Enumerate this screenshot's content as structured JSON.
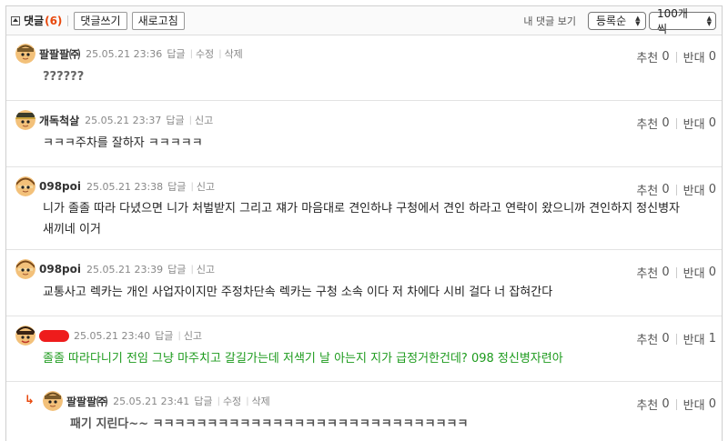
{
  "toolbar": {
    "title": "댓글",
    "count": "(6)",
    "write_label": "댓글쓰기",
    "refresh_label": "새로고침",
    "view_mine_label": "내 댓글 보기",
    "sort_value": "등록순",
    "page_size_value": "100개씩"
  },
  "comments": [
    {
      "nick": "팔팔팔㈜",
      "date": "25.05.21 23:36",
      "actions": [
        "답글",
        "수정",
        "삭제"
      ],
      "text": "??????",
      "up_label": "추천",
      "up": "0",
      "down_label": "반대",
      "down": "0"
    },
    {
      "nick": "개독척살",
      "date": "25.05.21 23:37",
      "actions": [
        "답글",
        "신고"
      ],
      "text": "ㅋㅋㅋ주차를 잘하자 ㅋㅋㅋㅋㅋ",
      "up_label": "추천",
      "up": "0",
      "down_label": "반대",
      "down": "0"
    },
    {
      "nick": "098poi",
      "date": "25.05.21 23:38",
      "actions": [
        "답글",
        "신고"
      ],
      "text": "니가 졸졸 따라 다녔으면 니가 처벌받지 그리고 쟤가 마음대로 견인하냐 구청에서 견인 하라고 연락이 왔으니까 견인하지 정신병자 새끼네 이거",
      "up_label": "추천",
      "up": "0",
      "down_label": "반대",
      "down": "0"
    },
    {
      "nick": "098poi",
      "date": "25.05.21 23:39",
      "actions": [
        "답글",
        "신고"
      ],
      "text": "교통사고 렉카는 개인 사업자이지만 주정차단속 렉카는 구청 소속 이다 저 차에다 시비 걸다 너 잡혀간다",
      "up_label": "추천",
      "up": "0",
      "down_label": "반대",
      "down": "0"
    },
    {
      "nick": "",
      "date": "25.05.21 23:40",
      "actions": [
        "답글",
        "신고"
      ],
      "text": "졸졸 따라다니기 전임 그냥 마주치고 갈길가는데 저색기 날 아는지 지가 급정거한건데? 098 정신병자련아",
      "up_label": "추천",
      "up": "0",
      "down_label": "반대",
      "down": "1"
    },
    {
      "nick": "팔팔팔㈜",
      "date": "25.05.21 23:41",
      "actions": [
        "답글",
        "수정",
        "삭제"
      ],
      "text": "패기 지린다~~ ㅋㅋㅋㅋㅋㅋㅋㅋㅋㅋㅋㅋㅋㅋㅋㅋㅋㅋㅋㅋㅋㅋㅋㅋㅋㅋㅋㅋㅋ",
      "up_label": "추천",
      "up": "0",
      "down_label": "반대",
      "down": "0"
    }
  ],
  "reply_marker": "↳",
  "colors": {
    "count": "#e8480c",
    "green_text": "#1d9b1d",
    "redaction": "#ee1c1c"
  }
}
